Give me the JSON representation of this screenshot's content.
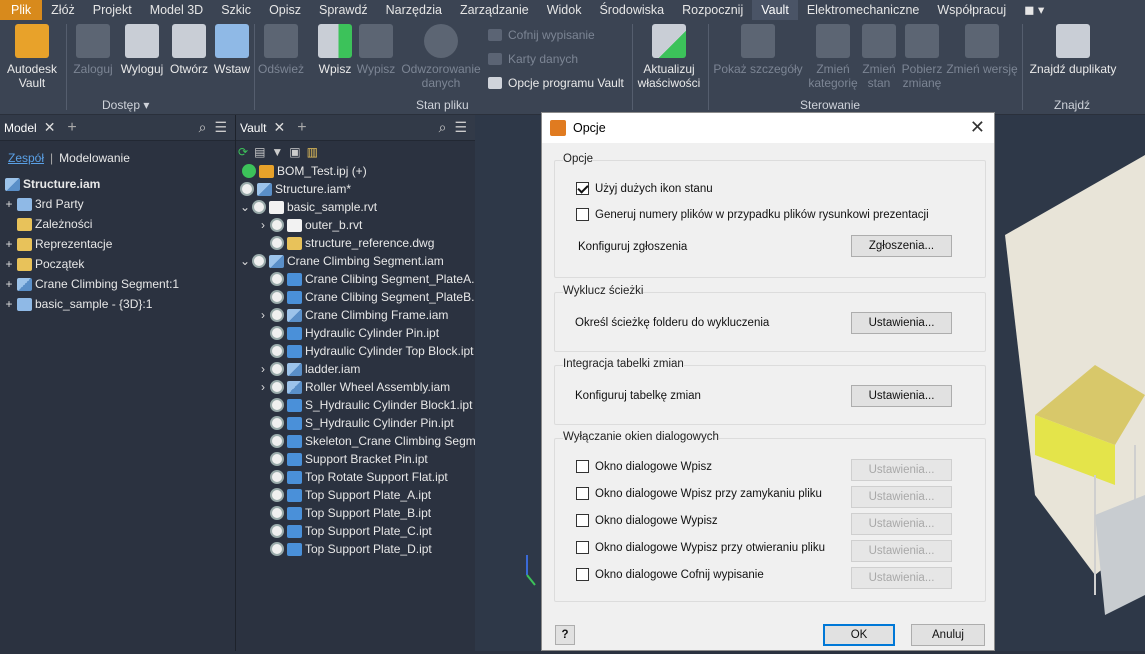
{
  "menu": [
    "Plik",
    "Złóż",
    "Projekt",
    "Model 3D",
    "Szkic",
    "Opisz",
    "Sprawdź",
    "Narzędzia",
    "Zarządzanie",
    "Widok",
    "Środowiska",
    "Rozpocznij",
    "Vault",
    "Elektromechaniczne",
    "Współpracuj"
  ],
  "ribbon": {
    "autodesk_vault": "Autodesk Vault",
    "zaloguj": "Zaloguj",
    "wyloguj": "Wyloguj",
    "otworz": "Otwórz",
    "wstaw": "Wstaw",
    "odswiez": "Odśwież",
    "wpisz": "Wpisz",
    "wypisz": "Wypisz",
    "odwzorowanie": "Odwzorowanie danych",
    "cofnij": "Cofnij wypisanie",
    "karty": "Karty danych",
    "opcje": "Opcje programu Vault",
    "aktualizuj": "Aktualizuj właściwości",
    "pokaz": "Pokaż szczegóły",
    "zmien_kat": "Zmień kategorię",
    "zmien_stan": "Zmień stan",
    "pobierz": "Pobierz zmianę",
    "zmien_wersje": "Zmień wersję",
    "znajdz_dup": "Znajdź duplikaty",
    "g_dostep": "Dostęp ▾",
    "g_stan": "Stan pliku",
    "g_sterowanie": "Sterowanie",
    "g_znajdz": "Znajdź"
  },
  "model_panel": {
    "tab": "Model",
    "sub1": "Zespół",
    "sub2": "Modelowanie",
    "items": [
      "Structure.iam",
      "3rd Party",
      "Zależności",
      "Reprezentacje",
      "Początek",
      "Crane Climbing Segment:1",
      "basic_sample - {3D}:1"
    ]
  },
  "vault_panel": {
    "tab": "Vault",
    "items": [
      "BOM_Test.ipj (+)",
      "Structure.iam*",
      "basic_sample.rvt",
      "outer_b.rvt",
      "structure_reference.dwg",
      "Crane Climbing Segment.iam",
      "Crane Clibing Segment_PlateA.ipt",
      "Crane Clibing Segment_PlateB.ipt",
      "Crane Climbing Frame.iam",
      "Hydraulic Cylinder Pin.ipt",
      "Hydraulic Cylinder Top Block.ipt",
      "ladder.iam",
      "Roller Wheel Assembly.iam",
      "S_Hydraulic Cylinder Block1.ipt",
      "S_Hydraulic Cylinder Pin.ipt",
      "Skeleton_Crane Climbing Segment",
      "Support Bracket Pin.ipt",
      "Top Rotate Support Flat.ipt",
      "Top Support Plate_A.ipt",
      "Top Support Plate_B.ipt",
      "Top Support Plate_C.ipt",
      "Top Support Plate_D.ipt"
    ]
  },
  "dialog": {
    "title": "Opcje",
    "g1": "Opcje",
    "cb1": "Użyj dużych ikon stanu",
    "cb2": "Generuj numery plików w przypadku plików rysunkowi prezentacji",
    "konf_zgl": "Konfiguruj zgłoszenia",
    "btn_zgl": "Zgłoszenia...",
    "g2": "Wyklucz ścieżki",
    "okresl": "Określ ścieżkę folderu do wykluczenia",
    "btn_ust": "Ustawienia...",
    "g3": "Integracja tabelki zmian",
    "konf_tab": "Konfiguruj tabelkę zmian",
    "g4": "Wyłączanie okien dialogowych",
    "d1": "Okno dialogowe Wpisz",
    "d2": "Okno dialogowe Wpisz przy zamykaniu pliku",
    "d3": "Okno dialogowe Wypisz",
    "d4": "Okno dialogowe Wypisz przy otwieraniu pliku",
    "d5": "Okno dialogowe Cofnij wypisanie",
    "ok": "OK",
    "cancel": "Anuluj",
    "help": "?"
  }
}
